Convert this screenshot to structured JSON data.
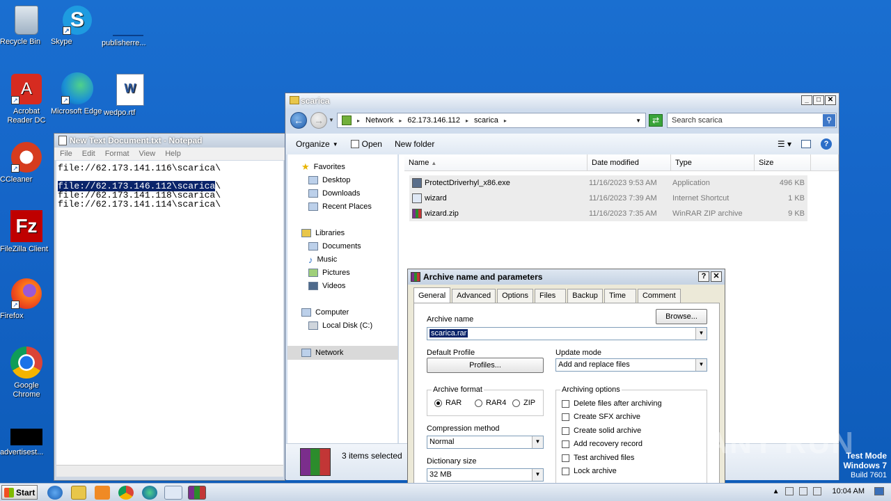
{
  "desktop": {
    "icons": [
      {
        "label": "Recycle Bin",
        "icon": "recycle-bin-icon"
      },
      {
        "label": "Skype",
        "icon": "skype-icon"
      },
      {
        "label": "publisherre...",
        "icon": "blank-file-icon"
      },
      {
        "label": "Acrobat Reader DC",
        "icon": "acrobat-icon"
      },
      {
        "label": "Microsoft Edge",
        "icon": "edge-icon"
      },
      {
        "label": "wedpo.rtf",
        "icon": "word-doc-icon"
      },
      {
        "label": "CCleaner",
        "icon": "ccleaner-icon"
      },
      {
        "label": "FileZilla Client",
        "icon": "filezilla-icon"
      },
      {
        "label": "Firefox",
        "icon": "firefox-icon"
      },
      {
        "label": "Google Chrome",
        "icon": "chrome-icon"
      },
      {
        "label": "advertisest...",
        "icon": "black-file-icon"
      }
    ]
  },
  "notepad": {
    "title": "New Text Document.txt - Notepad",
    "menu": [
      "File",
      "Edit",
      "Format",
      "View",
      "Help"
    ],
    "lines": [
      "file://62.173.141.116\\scarica\\",
      "",
      "file://62.173.146.112\\scarica",
      "file://62.173.141.118\\scarica\\",
      "file://62.173.141.114\\scarica\\"
    ],
    "line3_tail": "\\"
  },
  "explorer": {
    "title": "scarica",
    "breadcrumb": [
      "Network",
      "62.173.146.112",
      "scarica"
    ],
    "search_placeholder": "Search scarica",
    "toolbar": {
      "organize": "Organize",
      "open": "Open",
      "new_folder": "New folder"
    },
    "nav": {
      "favorites": "Favorites",
      "desktop": "Desktop",
      "downloads": "Downloads",
      "recent": "Recent Places",
      "libraries": "Libraries",
      "documents": "Documents",
      "music": "Music",
      "pictures": "Pictures",
      "videos": "Videos",
      "computer": "Computer",
      "localdisk": "Local Disk (C:)",
      "network": "Network"
    },
    "columns": [
      "Name",
      "Date modified",
      "Type",
      "Size"
    ],
    "files": [
      {
        "name": "ProtectDriverhyl_x86.exe",
        "date": "11/16/2023 9:53 AM",
        "type": "Application",
        "size": "496 KB"
      },
      {
        "name": "wizard",
        "date": "11/16/2023 7:39 AM",
        "type": "Internet Shortcut",
        "size": "1 KB"
      },
      {
        "name": "wizard.zip",
        "date": "11/16/2023 7:35 AM",
        "type": "WinRAR ZIP archive",
        "size": "9 KB"
      }
    ],
    "status": "3 items selected"
  },
  "dialog": {
    "title": "Archive name and parameters",
    "tabs": [
      "General",
      "Advanced",
      "Options",
      "Files",
      "Backup",
      "Time",
      "Comment"
    ],
    "archive_name_label": "Archive name",
    "archive_name_value": "scarica.rar",
    "browse": "Browse...",
    "default_profile_label": "Default Profile",
    "profiles_button": "Profiles...",
    "update_mode_label": "Update mode",
    "update_mode_value": "Add and replace files",
    "archive_format_label": "Archive format",
    "formats": [
      "RAR",
      "RAR4",
      "ZIP"
    ],
    "selected_format": "RAR",
    "compression_label": "Compression method",
    "compression_value": "Normal",
    "dictionary_label": "Dictionary size",
    "dictionary_value": "32 MB",
    "archiving_options_label": "Archiving options",
    "options": [
      "Delete files after archiving",
      "Create SFX archive",
      "Create solid archive",
      "Add recovery record",
      "Test archived files",
      "Lock archive"
    ]
  },
  "taskbar": {
    "start": "Start",
    "time": "10:04 AM"
  },
  "overlay": {
    "watermark": "ANY RUN",
    "mode": "Test Mode",
    "os": "Windows 7",
    "build": "Build 7601"
  }
}
